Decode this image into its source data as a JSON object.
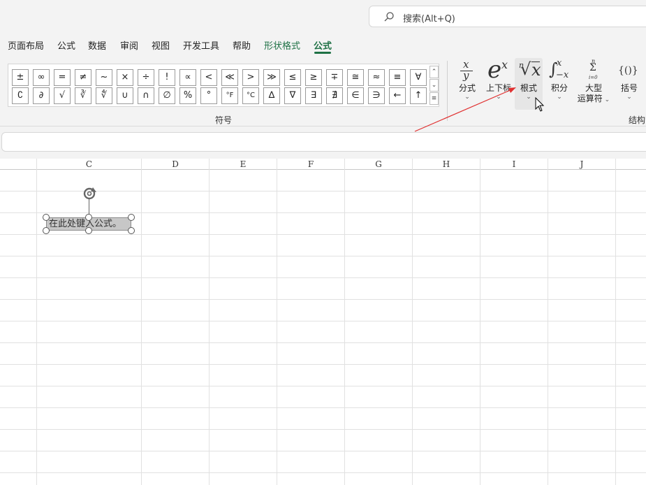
{
  "search": {
    "placeholder": "搜索(Alt+Q)"
  },
  "tabs": [
    {
      "label": "页面布局"
    },
    {
      "label": "公式"
    },
    {
      "label": "数据"
    },
    {
      "label": "审阅"
    },
    {
      "label": "视图"
    },
    {
      "label": "开发工具"
    },
    {
      "label": "帮助"
    },
    {
      "label": "形状格式"
    },
    {
      "label": "公式"
    }
  ],
  "symbols": {
    "row1": [
      "±",
      "∞",
      "=",
      "≠",
      "~",
      "×",
      "÷",
      "!",
      "∝",
      "<",
      "≪",
      ">",
      "≫",
      "≤",
      "≥",
      "∓",
      "≅",
      "≈",
      "≡",
      "∀"
    ],
    "row2": [
      "∁",
      "∂",
      "√",
      "∛",
      "∜",
      "∪",
      "∩",
      "∅",
      "%",
      "°",
      "°F",
      "°C",
      "∆",
      "∇",
      "∃",
      "∄",
      "∈",
      "∋",
      "←",
      "↑"
    ],
    "group_label": "符号"
  },
  "structures": {
    "group_label": "结构",
    "items": [
      {
        "label": "分式",
        "label2": ""
      },
      {
        "label": "上下标",
        "label2": ""
      },
      {
        "label": "根式",
        "label2": ""
      },
      {
        "label": "积分",
        "label2": ""
      },
      {
        "label": "大型",
        "label2": "运算符"
      },
      {
        "label": "括号",
        "label2": ""
      }
    ],
    "icons": {
      "fraction_num": "x",
      "fraction_den": "y",
      "script_base": "e",
      "script_sup": "x",
      "radical_index": "n",
      "radical_root": "√",
      "radical_x": "x",
      "integral_sign": "∫",
      "integral_up": "x",
      "integral_low": "−x",
      "sum_top": "n",
      "sum_sign": "Σ",
      "sum_bottom": "i=0",
      "bracket": "{()}"
    }
  },
  "columns": [
    "C",
    "D",
    "E",
    "F",
    "G",
    "H",
    "I",
    "J"
  ],
  "equation": {
    "text": "在此处键入公式。"
  },
  "colors": {
    "accent": "#1e7145",
    "arrow": "#e03030"
  }
}
